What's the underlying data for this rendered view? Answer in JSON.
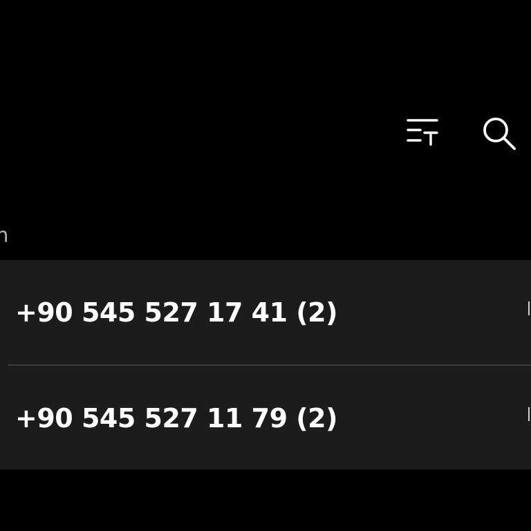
{
  "theme": {
    "background": "#000000",
    "list_background": "#1c1c1c",
    "divider": "#3a3a3a",
    "text_primary": "#ffffff",
    "text_secondary": "#b4b4b4"
  },
  "toolbar": {
    "filter_icon": "filter-list-icon",
    "search_icon": "search-icon"
  },
  "section": {
    "label": "in"
  },
  "calls": [
    {
      "number": "+90 545 527 17 41 (2)"
    },
    {
      "number": "+90 545 527 11 79 (2)"
    }
  ]
}
